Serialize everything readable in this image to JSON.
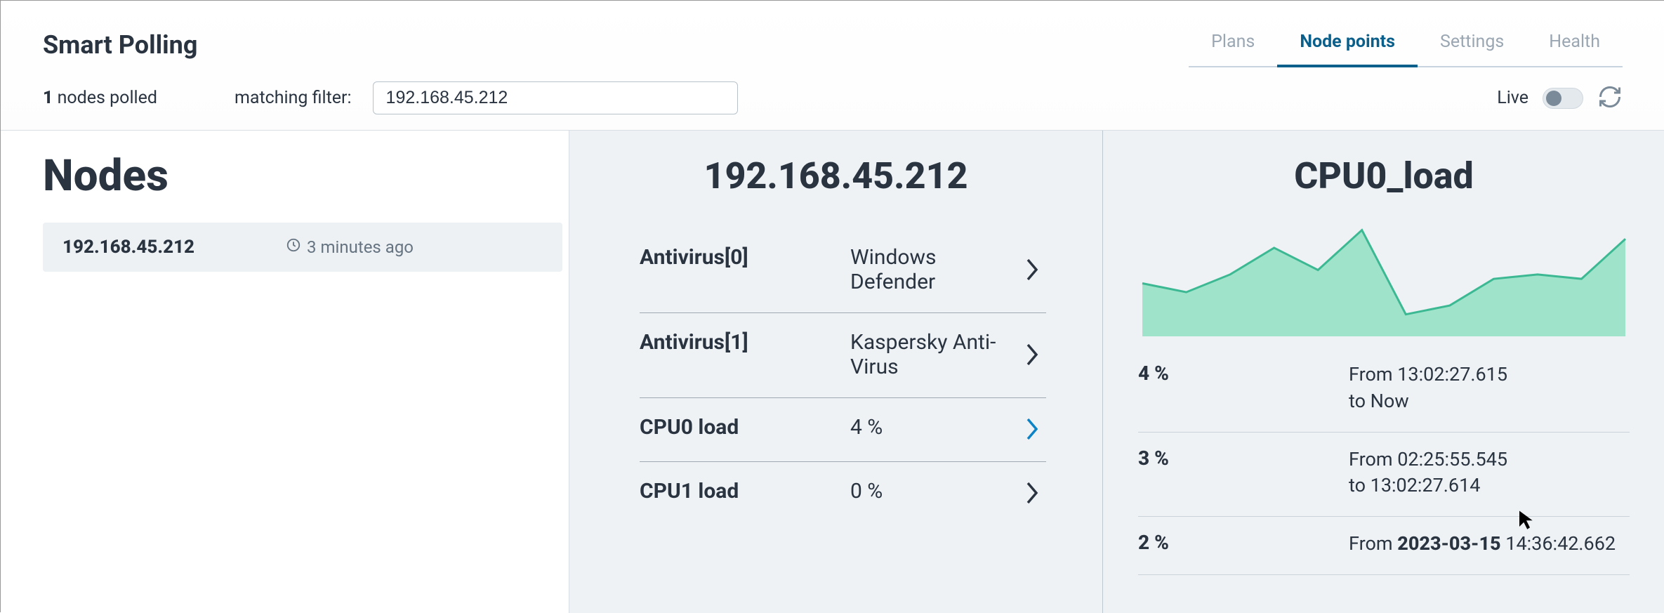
{
  "header": {
    "app_title": "Smart Polling",
    "tabs": [
      "Plans",
      "Node points",
      "Settings",
      "Health"
    ],
    "active_tab_index": 1,
    "nodes_polled_count": "1",
    "nodes_polled_suffix": " nodes polled",
    "matching_filter_label": "matching filter:",
    "filter_value": "192.168.45.212",
    "live_label": "Live",
    "live_on": false
  },
  "nodes_panel": {
    "heading": "Nodes",
    "rows": [
      {
        "ip": "192.168.45.212",
        "age": "3 minutes ago"
      }
    ]
  },
  "detail_panel": {
    "ip": "192.168.45.212",
    "metrics": [
      {
        "name": "Antivirus[0]",
        "value": "Windows Defender",
        "active": false
      },
      {
        "name": "Antivirus[1]",
        "value": "Kaspersky Anti-Virus",
        "active": false
      },
      {
        "name": "CPU0 load",
        "value": "4 %",
        "active": true
      },
      {
        "name": "CPU1 load",
        "value": "0 %",
        "active": false
      }
    ]
  },
  "chart_panel": {
    "title": "CPU0_load",
    "history": [
      {
        "value": "4 %",
        "range_prefix": "From ",
        "range_bold": "",
        "range_a": "13:02:27.615",
        "mid": " to ",
        "range_b": "Now"
      },
      {
        "value": "3 %",
        "range_prefix": "From ",
        "range_bold": "",
        "range_a": "02:25:55.545",
        "mid": " to ",
        "range_b": "13:02:27.614"
      },
      {
        "value": "2 %",
        "range_prefix": "From ",
        "range_bold": "2023-03-15",
        "range_a": " 14:36:42.662",
        "mid": "",
        "range_b": ""
      }
    ]
  },
  "chart_data": {
    "type": "area",
    "title": "CPU0_load",
    "ylabel": "%",
    "ylim": [
      0,
      5
    ],
    "x": [
      0,
      1,
      2,
      3,
      4,
      5,
      6,
      7,
      8,
      9,
      10,
      11
    ],
    "values": [
      2.2,
      1.8,
      2.6,
      3.8,
      2.8,
      4.6,
      0.8,
      1.2,
      2.4,
      2.6,
      2.4,
      4.2
    ]
  }
}
